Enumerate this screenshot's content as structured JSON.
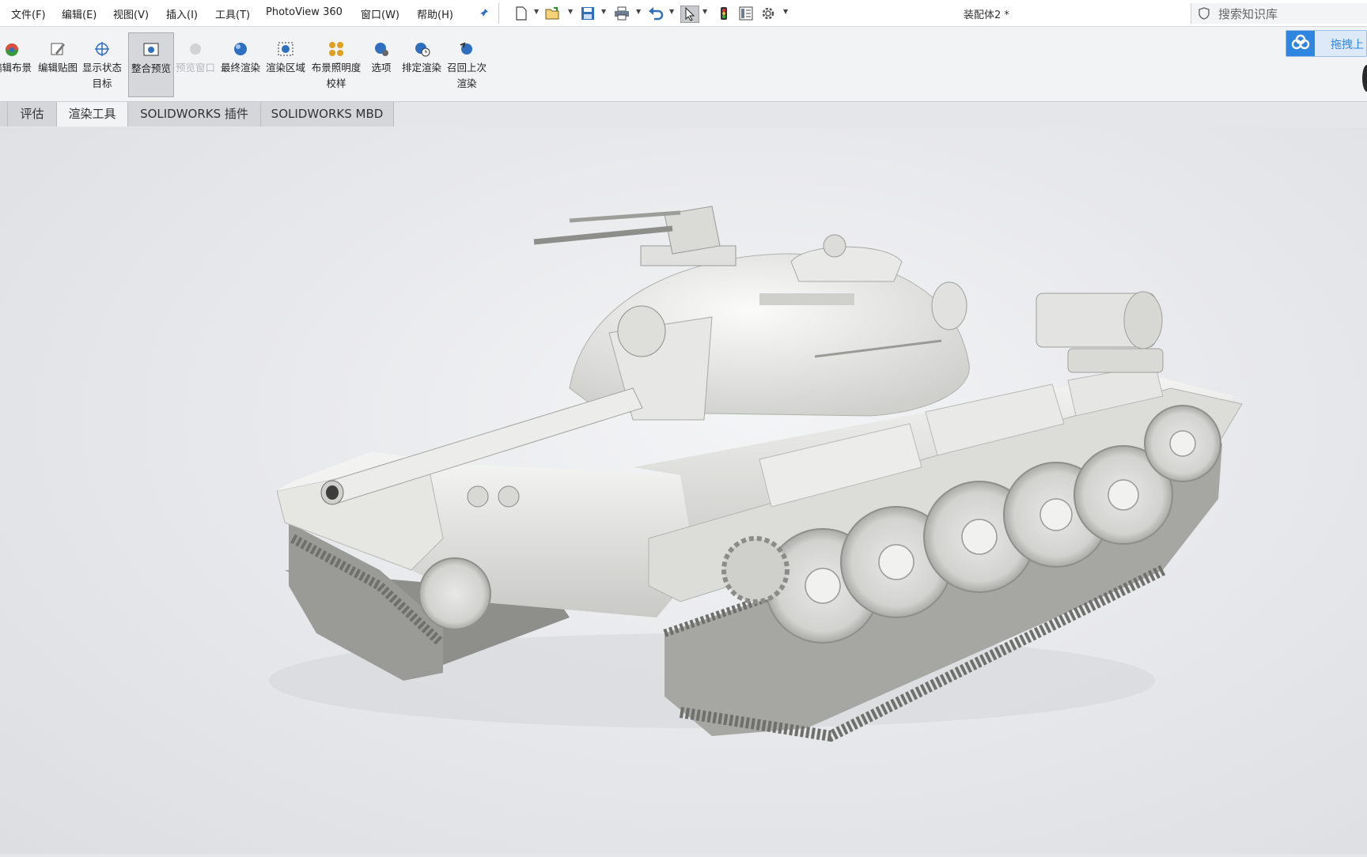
{
  "menubar": {
    "items": [
      "文件(F)",
      "编辑(E)",
      "视图(V)",
      "插入(I)",
      "工具(T)",
      "PhotoView 360",
      "窗口(W)",
      "帮助(H)"
    ]
  },
  "document": {
    "title": "装配体2 *"
  },
  "search": {
    "placeholder": "搜索知识库"
  },
  "cloud_button": {
    "label": "拖拽上"
  },
  "ribbon": {
    "buttons": [
      {
        "label": "编辑布景"
      },
      {
        "label": "编辑贴图"
      },
      {
        "label": "显示状态目标"
      },
      {
        "label": "整合预览"
      },
      {
        "label": "预览窗口"
      },
      {
        "label": "最终渲染"
      },
      {
        "label": "渲染区域"
      },
      {
        "label": "布景照明度校样"
      },
      {
        "label": "选项"
      },
      {
        "label": "排定渲染"
      },
      {
        "label": "召回上次渲染"
      }
    ]
  },
  "tabs": [
    "评估",
    "渲染工具",
    "SOLIDWORKS 插件",
    "SOLIDWORKS MBD"
  ],
  "colors": {
    "accent": "#2f86e0",
    "ribbon_bg": "#f2f3f5",
    "viewport": "#e8e9ec"
  }
}
